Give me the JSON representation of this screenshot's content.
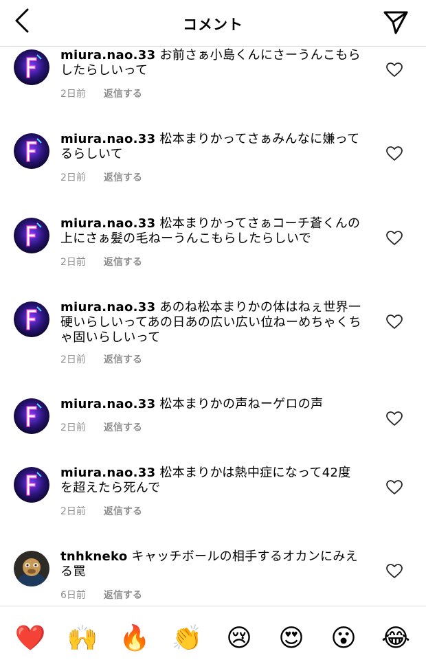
{
  "header": {
    "title": "コメント"
  },
  "comments": [
    {
      "username": "miura.nao.33",
      "text": "お前さぁ小島くんにさーうんこもらしたらしいって",
      "time": "2日前",
      "reply_label": "返信する"
    },
    {
      "username": "miura.nao.33",
      "text": "松本まりかってさぁみんなに嫌ってるらしいて",
      "time": "2日前",
      "reply_label": "返信する"
    },
    {
      "username": "miura.nao.33",
      "text": "松本まりかってさぁコーチ蒼くんの上にさぁ髪の毛ねーうんこもらしたらしいで",
      "time": "2日前",
      "reply_label": "返信する"
    },
    {
      "username": "miura.nao.33",
      "text": "あのね松本まりかの体はねぇ世界一硬いらしいってあの日あの広い広い位ねーめちゃくちゃ固いらしいって",
      "time": "2日前",
      "reply_label": "返信する"
    },
    {
      "username": "miura.nao.33",
      "text": "松本まりかの声ねーゲロの声",
      "time": "2日前",
      "reply_label": "返信する"
    },
    {
      "username": "miura.nao.33",
      "text": "松本まりかは熱中症になって42度を超えたら死んで",
      "time": "2日前",
      "reply_label": "返信する"
    },
    {
      "username": "tnhkneko",
      "text": "キャッチボールの相手するオカンにみえる罠",
      "time": "6日前",
      "reply_label": "返信する"
    }
  ],
  "emoji_bar": [
    "❤️",
    "🙌",
    "🔥",
    "👏",
    "😢",
    "😍",
    "😮",
    "😂"
  ],
  "icons": {
    "back": "chevron-left-icon",
    "send": "paper-plane-icon",
    "like": "heart-outline-icon"
  }
}
